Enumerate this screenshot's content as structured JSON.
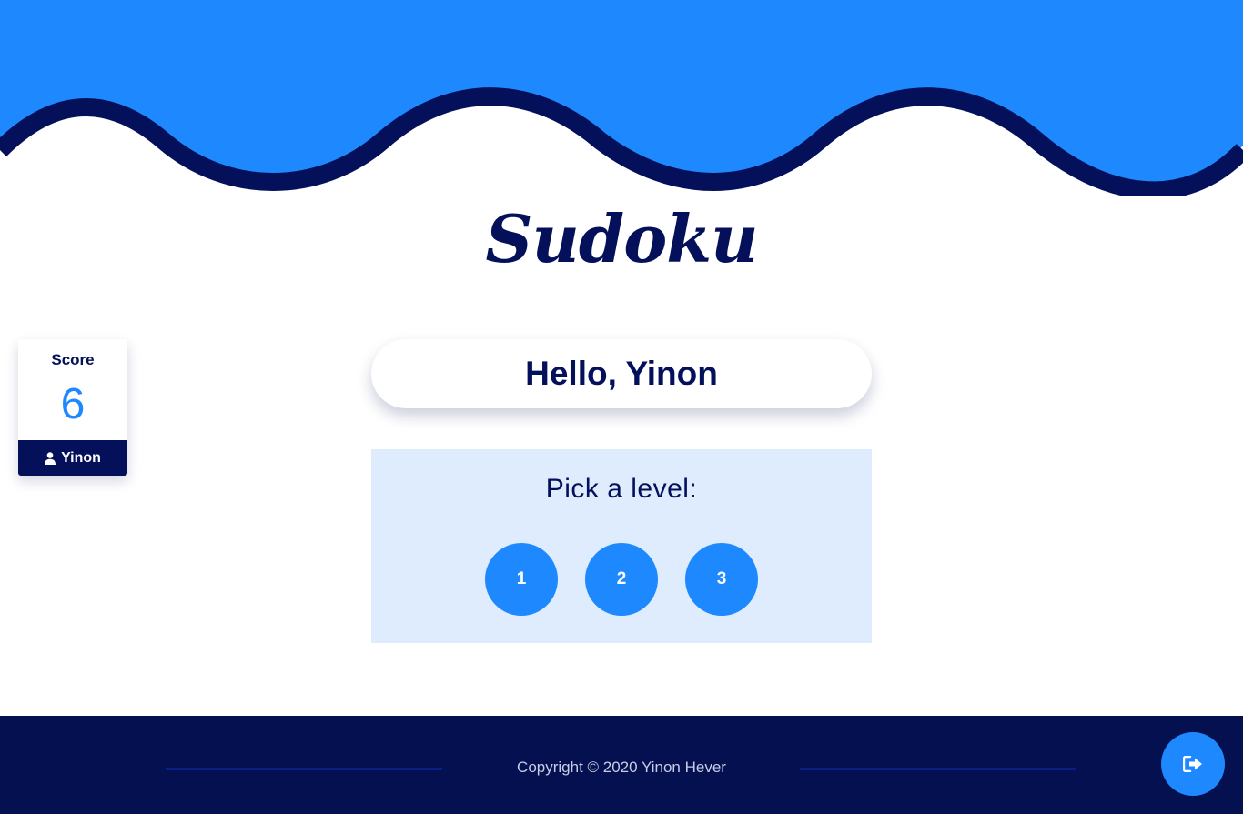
{
  "header": {
    "title": "Sudoku",
    "colors": {
      "wave_fill": "#1e88ff",
      "wave_stroke": "#04115a"
    }
  },
  "score_card": {
    "label": "Score",
    "value": "6",
    "user_name": "Yinon",
    "user_icon": "user-icon"
  },
  "greeting": "Hello, Yinon",
  "level_picker": {
    "title": "Pick a level:",
    "levels": [
      "1",
      "2",
      "3"
    ]
  },
  "footer": {
    "copyright": "Copyright © 2020 Yinon Hever"
  },
  "logout": {
    "icon": "sign-out-icon"
  }
}
